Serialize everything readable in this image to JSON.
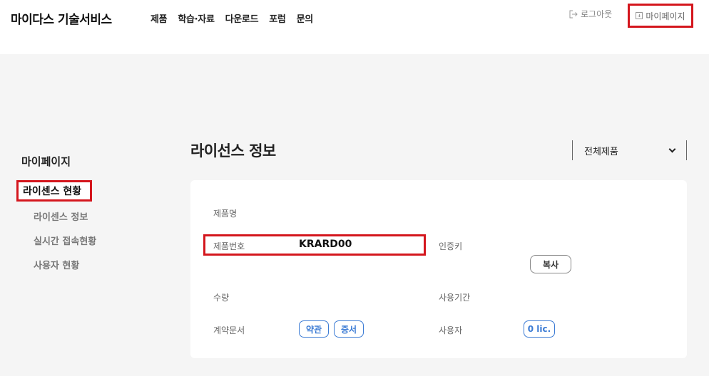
{
  "header": {
    "brand": "마이다스 기술서비스",
    "nav": [
      "제품",
      "학습·자료",
      "다운로드",
      "포럼",
      "문의"
    ],
    "logout_label": "로그아웃",
    "mypage_label": "마이페이지"
  },
  "sidebar": {
    "title": "마이페이지",
    "active_section": "라이센스 현황",
    "items": [
      "라이센스 정보",
      "실시간 접속현황",
      "사용자 현황"
    ]
  },
  "content": {
    "title": "라이선스 정보",
    "product_select": {
      "selected": "전체제품"
    },
    "fields": {
      "product_name_label": "제품명",
      "product_number_label": "제품번호",
      "product_number_value": "KRARD00",
      "auth_key_label": "인증키",
      "copy_button": "복사",
      "quantity_label": "수량",
      "period_label": "사용기간",
      "contract_label": "계약문서",
      "terms_button": "약관",
      "certificate_button": "증서",
      "user_label": "사용자",
      "user_count": "0 lic."
    }
  }
}
